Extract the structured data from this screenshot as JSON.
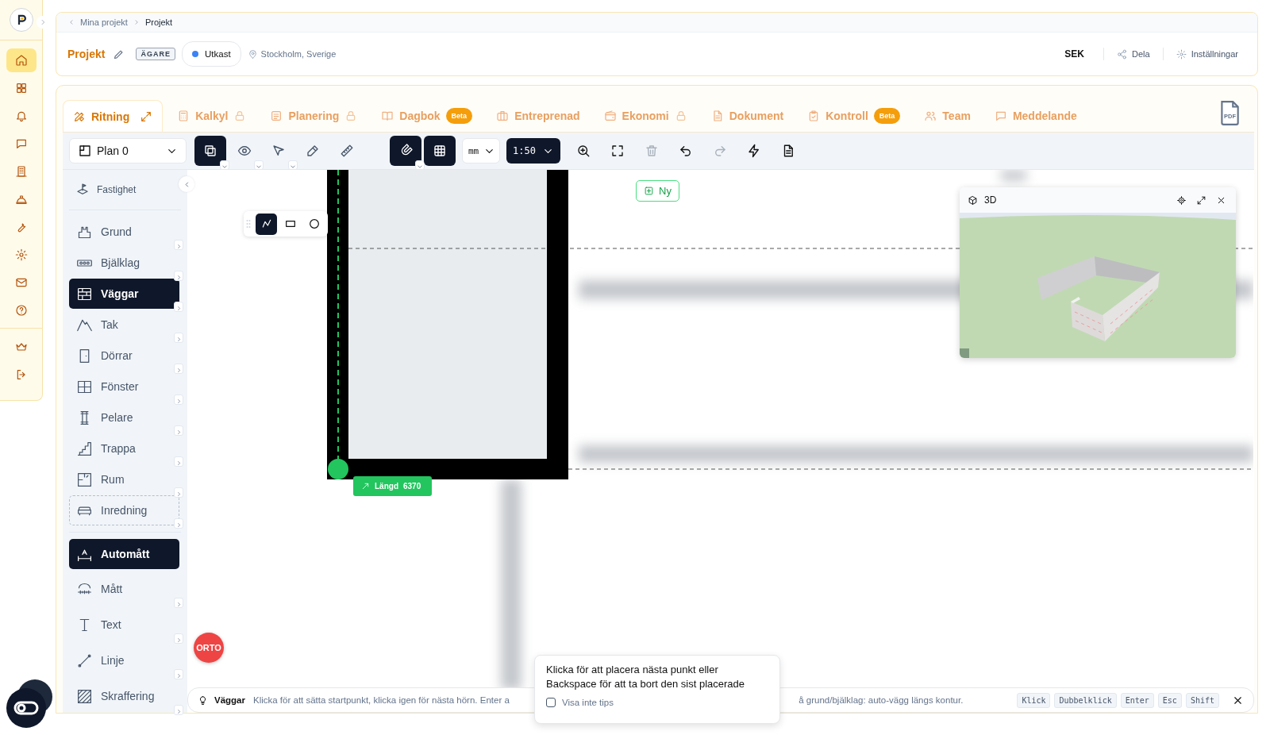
{
  "rail": {
    "items": [
      {
        "selected": true
      },
      {
        "selected": false
      },
      {
        "selected": false
      },
      {
        "selected": false
      },
      {
        "selected": false
      },
      {
        "selected": false
      },
      {
        "selected": false
      },
      {
        "selected": false
      },
      {
        "selected": false
      },
      {
        "selected": false
      },
      {
        "selected": false
      },
      {
        "selected": false
      }
    ]
  },
  "breadcrumb": [
    {
      "label": "Mina projekt"
    },
    {
      "label": "Projekt"
    }
  ],
  "project": {
    "name": "Projekt",
    "role": "ÄGARE",
    "status": "Utkast",
    "location": "Stockholm, Sverige"
  },
  "header_actions": {
    "currency": "SEK",
    "share": "Dela",
    "settings": "Inställningar"
  },
  "tabs": [
    {
      "label": "Ritning",
      "selected": true,
      "locked": false,
      "expandable": true
    },
    {
      "label": "Kalkyl",
      "selected": false,
      "locked": true
    },
    {
      "label": "Planering",
      "selected": false,
      "locked": true
    },
    {
      "label": "Dagbok",
      "selected": false,
      "locked": false,
      "badge": "Beta"
    },
    {
      "label": "Entreprenad",
      "selected": false,
      "locked": false
    },
    {
      "label": "Ekonomi",
      "selected": false,
      "locked": true
    },
    {
      "label": "Dokument",
      "selected": false,
      "locked": false
    },
    {
      "label": "Kontroll",
      "selected": false,
      "locked": false,
      "badge": "Beta"
    },
    {
      "label": "Team",
      "selected": false,
      "locked": false
    },
    {
      "label": "Meddelande",
      "selected": false,
      "locked": false
    }
  ],
  "toolbar": {
    "plan_select": "Plan 0",
    "tools": [
      {
        "active": true,
        "menu": true
      },
      {
        "active": false,
        "menu": true
      },
      {
        "active": false,
        "menu": true
      },
      {
        "active": false,
        "menu": false
      },
      {
        "active": false,
        "menu": false
      },
      {
        "active": true,
        "menu": true
      },
      {
        "active": true,
        "menu": false
      }
    ],
    "unit_select": "mm",
    "scale_select": "1:50",
    "pdf_label": "PDF",
    "actions": [
      {
        "disabled": false
      },
      {
        "disabled": false
      },
      {
        "disabled": true
      },
      {
        "disabled": false
      },
      {
        "disabled": true
      },
      {
        "disabled": false
      },
      {
        "disabled": false
      }
    ]
  },
  "tool_panel": {
    "property": "Fastighet",
    "tools": [
      {
        "label": "Grund",
        "selected": false,
        "kind": "tool"
      },
      {
        "label": "Bjälklag",
        "selected": false,
        "kind": "tool"
      },
      {
        "label": "Väggar",
        "selected": true,
        "kind": "tool"
      },
      {
        "label": "Tak",
        "selected": false,
        "kind": "tool"
      },
      {
        "label": "Dörrar",
        "selected": false,
        "kind": "tool"
      },
      {
        "label": "Fönster",
        "selected": false,
        "kind": "tool"
      },
      {
        "label": "Pelare",
        "selected": false,
        "kind": "tool"
      },
      {
        "label": "Trappa",
        "selected": false,
        "kind": "tool"
      },
      {
        "label": "Rum",
        "selected": false,
        "kind": "tool"
      },
      {
        "label": "Inredning",
        "selected": false,
        "kind": "library"
      }
    ],
    "measure_tools": [
      {
        "label": "Automått",
        "selected": true,
        "menu": false
      },
      {
        "label": "Mått",
        "selected": false,
        "menu": true
      },
      {
        "label": "Text",
        "selected": false,
        "menu": true
      },
      {
        "label": "Linje",
        "selected": false,
        "menu": true
      },
      {
        "label": "Skraffering",
        "selected": false,
        "menu": true
      }
    ]
  },
  "canvas": {
    "shape_modes": [
      {
        "selected": true
      },
      {
        "selected": false
      },
      {
        "selected": false
      }
    ],
    "new_button": "Ny",
    "length_label": "Längd",
    "length_value": "6370",
    "ortho": "ORTO",
    "preview": {
      "title": "3D",
      "kind": "picture"
    }
  },
  "status_bar": {
    "tool": "Väggar",
    "hint_start": "Klicka för att sätta startpunkt, klicka igen för nästa hörn. Enter a",
    "hint_end": "å grund/bjälklag: auto-vägg längs kontur.",
    "keys": [
      "Klick",
      "Dubbelklick",
      "Enter",
      "Esc",
      "Shift"
    ]
  },
  "tip": {
    "text": "Klicka för att placera nästa punkt eller Backspace för att ta bort den sist placerade",
    "dont_show": {
      "label": "Visa inte tips",
      "checked": false
    }
  }
}
